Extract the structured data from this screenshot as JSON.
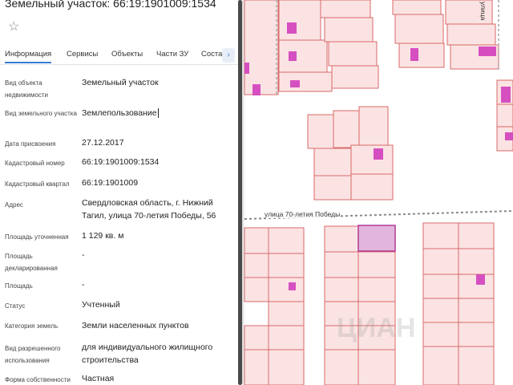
{
  "header": {
    "title": "Земельный участок: 66:19:1901009:1534"
  },
  "tabs": [
    {
      "label": "Информация",
      "active": true
    },
    {
      "label": "Сервисы",
      "active": false
    },
    {
      "label": "Объекты",
      "active": false
    },
    {
      "label": "Части ЗУ",
      "active": false
    },
    {
      "label": "Соста",
      "active": false
    }
  ],
  "fields": [
    {
      "label": "Вид объекта недвижимости",
      "value": "Земельный участок"
    },
    {
      "label": "Вид земельного участка",
      "value": "Землепользование"
    },
    {
      "label": "Дата присвоения",
      "value": "27.12.2017"
    },
    {
      "label": "Кадастровый номер",
      "value": "66:19:1901009:1534"
    },
    {
      "label": "Кадастровый квартал",
      "value": "66:19:1901009"
    },
    {
      "label": "Адрес",
      "value": "Свердловская область, г. Нижний Тагил, улица 70-летия Победы, 56"
    },
    {
      "label": "Площадь уточненная",
      "value": "1 129 кв. м"
    },
    {
      "label": "Площадь декларированная",
      "value": "-"
    },
    {
      "label": "Площадь",
      "value": "-"
    },
    {
      "label": "Статус",
      "value": "Учтенный"
    },
    {
      "label": "Категория земель",
      "value": "Земли населенных пунктов"
    },
    {
      "label": "Вид разрешенного использования",
      "value": "для индивидуального жилищного строительства"
    },
    {
      "label": "Форма собственности",
      "value": "Частная"
    }
  ],
  "map": {
    "street_label": "улица 70-летия Победы",
    "street_label_top": "улица",
    "watermark": "ЦИАН",
    "colors": {
      "parcel_fill": "#fbe3e3",
      "parcel_stroke": "#d86a6a",
      "building_fill": "#d64fc1",
      "selected_fill": "#e2b5dc",
      "selected_stroke": "#b03a95"
    }
  }
}
